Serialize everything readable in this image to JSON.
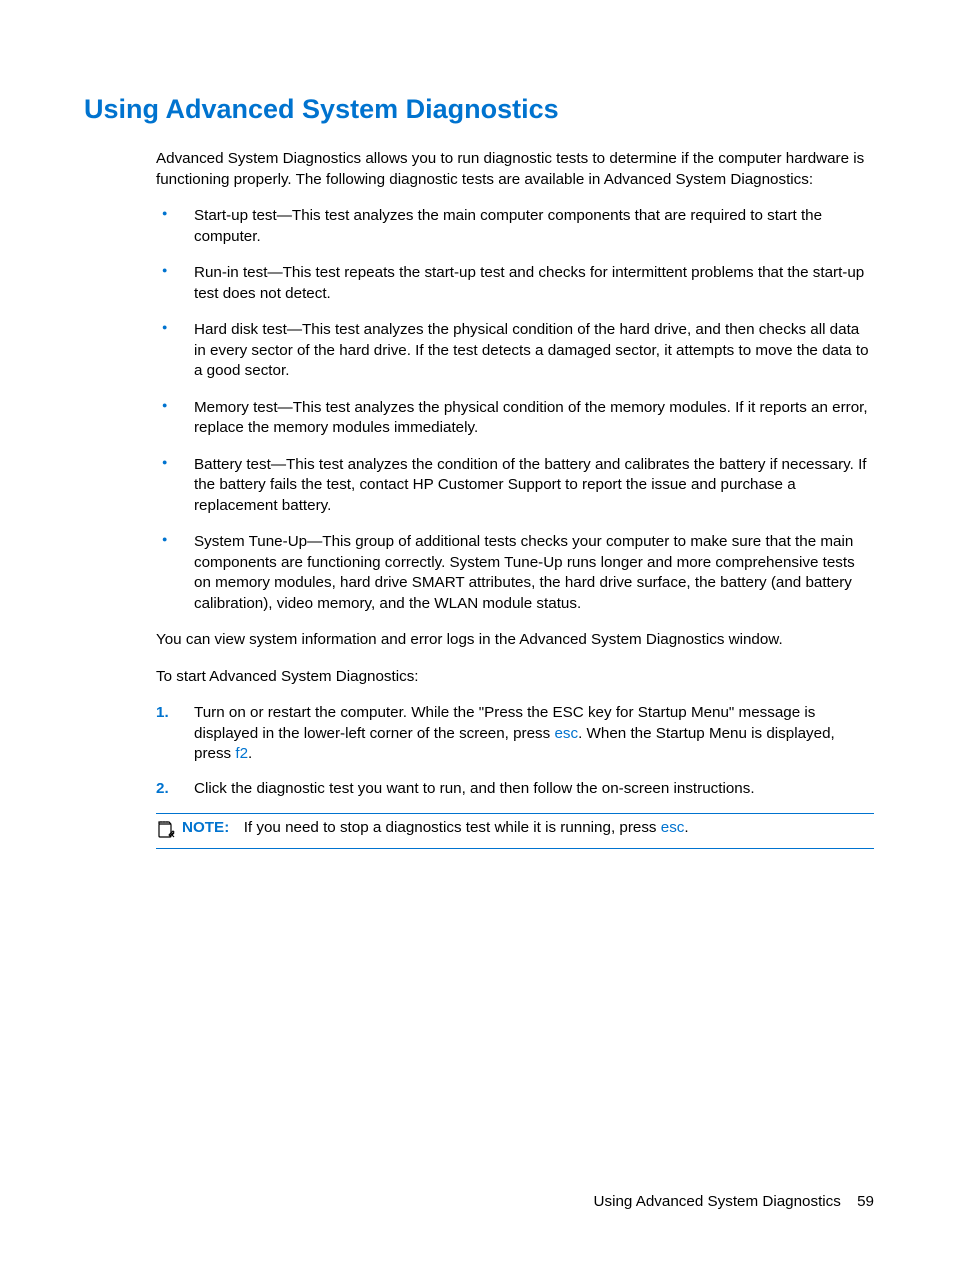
{
  "heading": "Using Advanced System Diagnostics",
  "intro": "Advanced System Diagnostics allows you to run diagnostic tests to determine if the computer hardware is functioning properly. The following diagnostic tests are available in Advanced System Diagnostics:",
  "tests": [
    "Start-up test—This test analyzes the main computer components that are required to start the computer.",
    "Run-in test—This test repeats the start-up test and checks for intermittent problems that the start-up test does not detect.",
    "Hard disk test—This test analyzes the physical condition of the hard drive, and then checks all data in every sector of the hard drive. If the test detects a damaged sector, it attempts to move the data to a good sector.",
    "Memory test—This test analyzes the physical condition of the memory modules. If it reports an error, replace the memory modules immediately.",
    "Battery test—This test analyzes the condition of the battery and calibrates the battery if necessary. If the battery fails the test, contact HP Customer Support to report the issue and purchase a replacement battery.",
    "System Tune-Up—This group of additional tests checks your computer to make sure that the main components are functioning correctly. System Tune-Up runs longer and more comprehensive tests on memory modules, hard drive SMART attributes, the hard drive surface, the battery (and battery calibration), video memory, and the WLAN module status."
  ],
  "para_info": "You can view system information and error logs in the Advanced System Diagnostics window.",
  "para_start": "To start Advanced System Diagnostics:",
  "step1": {
    "pre": "Turn on or restart the computer. While the \"Press the ESC key for Startup Menu\" message is displayed in the lower-left corner of the screen, press ",
    "k1": "esc",
    "mid": ". When the Startup Menu is displayed, press ",
    "k2": "f2",
    "post": "."
  },
  "step2": "Click the diagnostic test you want to run, and then follow the on-screen instructions.",
  "note": {
    "label": "NOTE:",
    "pre": "If you need to stop a diagnostics test while it is running, press ",
    "k": "esc",
    "post": "."
  },
  "footer": {
    "title": "Using Advanced System Diagnostics",
    "page": "59"
  }
}
